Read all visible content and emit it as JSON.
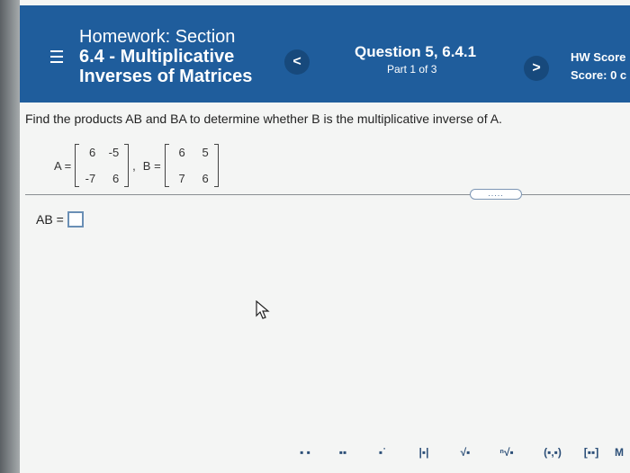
{
  "header": {
    "title_line1": "Homework: Section",
    "title_line2": "6.4 - Multiplicative",
    "title_line3": "Inverses of Matrices",
    "question": "Question 5, 6.4.1",
    "part": "Part 1 of 3",
    "hw_score_label": "HW Score",
    "score_label": "Score: 0 c",
    "prev_glyph": "<",
    "next_glyph": ">"
  },
  "problem": {
    "instruction": "Find the products AB and BA to determine whether B is the multiplicative inverse of A.",
    "matrix_a_label": "A =",
    "matrix_a": [
      [
        "6",
        "-5"
      ],
      [
        "-7",
        "6"
      ]
    ],
    "matrix_b_label": "B =",
    "matrix_b": [
      [
        "6",
        "5"
      ],
      [
        "7",
        "6"
      ]
    ],
    "separator": ",",
    "more_dots": ".....",
    "answer_label": "AB ="
  },
  "toolbar": {
    "items": [
      {
        "name": "fraction-tool",
        "glyph": "▪\n▪"
      },
      {
        "name": "mixed-number-tool",
        "glyph": "▪▪"
      },
      {
        "name": "exponent-tool",
        "glyph": "▪˙"
      },
      {
        "name": "absolute-value-tool",
        "glyph": "|▪|"
      },
      {
        "name": "sqrt-tool",
        "glyph": "√▪"
      },
      {
        "name": "nth-root-tool",
        "glyph": "ⁿ√▪"
      },
      {
        "name": "ordered-pair-tool",
        "glyph": "(▪,▪)"
      },
      {
        "name": "matrix-tool",
        "glyph": "[▪▪]"
      },
      {
        "name": "more-tool",
        "glyph": "M"
      }
    ]
  },
  "colors": {
    "header_bg": "#1f5d9c",
    "nav_btn_bg": "#17497c",
    "accent": "#6a8fb5"
  }
}
